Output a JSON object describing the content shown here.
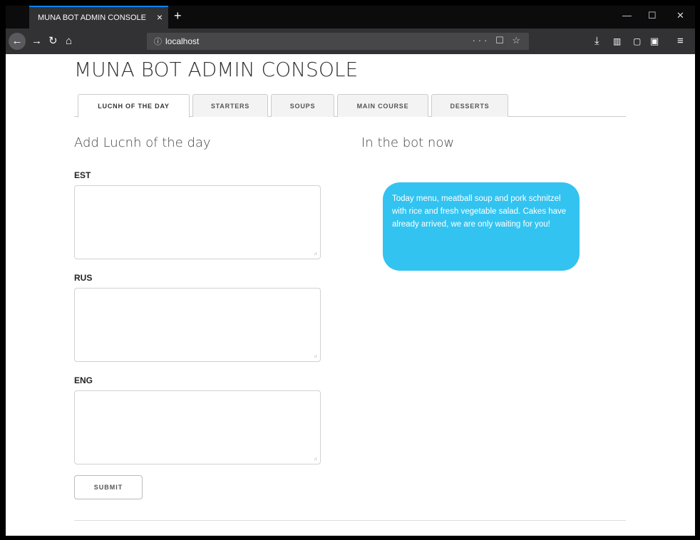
{
  "browser": {
    "tab_title": "MUNA BOT ADMIN CONSOLE",
    "tab_close": "×",
    "new_tab": "+",
    "url": "localhost",
    "url_info_icon": "ⓘ",
    "url_actions": "··· ☐ ☆",
    "icons": [
      "back-icon",
      "forward-icon",
      "reload-icon",
      "home-icon",
      "download-icon",
      "library-icon",
      "sidebar-icon",
      "account-icon",
      "menu-icon"
    ],
    "window_controls": [
      "—",
      "☐",
      "✕"
    ]
  },
  "page": {
    "title": "MUNA BOT ADMIN CONSOLE",
    "tabs": [
      {
        "label": "LUCNH OF THE DAY",
        "active": true
      },
      {
        "label": "STARTERS",
        "active": false
      },
      {
        "label": "SOUPS",
        "active": false
      },
      {
        "label": "MAIN COURSE",
        "active": false
      },
      {
        "label": "DESSERTS",
        "active": false
      }
    ],
    "form": {
      "heading": "Add Lucnh of the day",
      "fields": [
        {
          "label": "EST",
          "value": ""
        },
        {
          "label": "RUS",
          "value": ""
        },
        {
          "label": "ENG",
          "value": ""
        }
      ],
      "submit_label": "SUBMIT"
    },
    "preview": {
      "heading": "In the bot now",
      "message": "Today menu, meatball soup and pork schnitzel with rice and fresh vegetable salad. Cakes have already arrived, we are only waiting for you!"
    }
  },
  "colors": {
    "bubble": "#33c3f0",
    "chrome_dark": "#0c0c0d",
    "chrome_toolbar": "#323234",
    "tab_accent": "#0a84ff"
  }
}
